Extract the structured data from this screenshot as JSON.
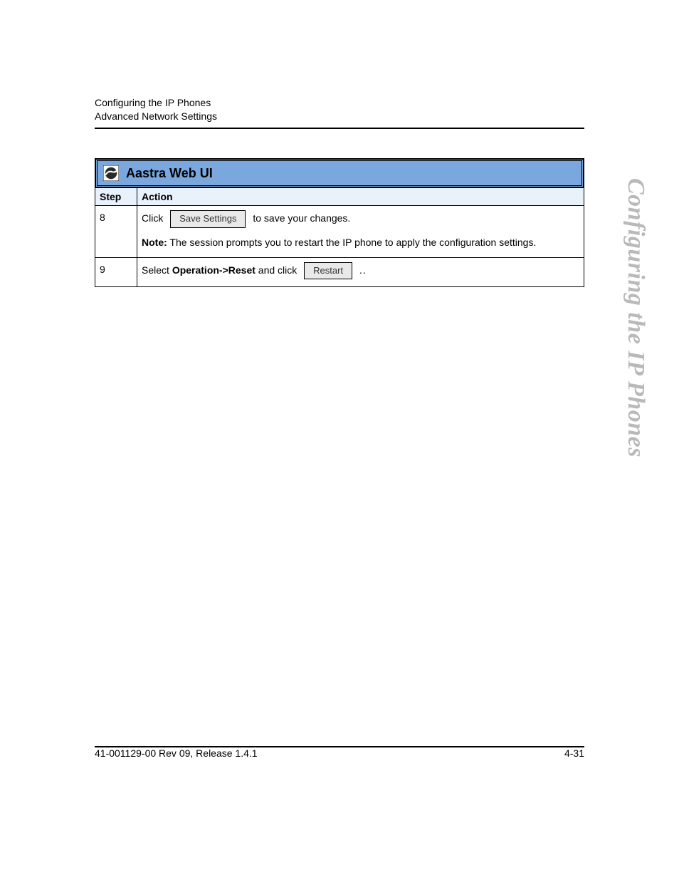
{
  "header": {
    "line1": "Configuring the IP Phones",
    "line2": "Advanced Network Settings"
  },
  "side_heading": "Configuring the IP Phones",
  "table": {
    "title": "Aastra Web UI",
    "icon": "globe-icon",
    "columns": {
      "step": "Step",
      "action": "Action"
    },
    "rows": [
      {
        "step": "8",
        "click_label": "Click",
        "button1": "Save Settings",
        "after_button1": "to save your changes.",
        "note_label": "Note:",
        "note_text": "The session prompts you to restart the IP phone to apply the configuration settings."
      },
      {
        "step": "9",
        "select_label": "Select",
        "op_path": "Operation->Reset",
        "and_click": "and click",
        "button2": "Restart",
        "trail": ".."
      }
    ]
  },
  "footer": {
    "left": "41-001129-00 Rev 09, Release 1.4.1",
    "right": "4-31"
  }
}
